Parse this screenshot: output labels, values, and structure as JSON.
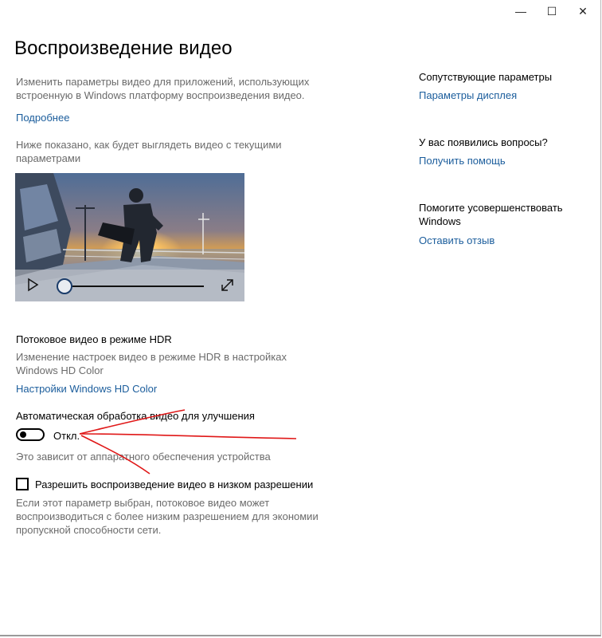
{
  "window": {
    "minimize_glyph": "—",
    "maximize_glyph": "☐",
    "close_glyph": "✕"
  },
  "page": {
    "title": "Воспроизведение видео",
    "intro": "Изменить параметры видео для приложений, использующих встроенную в Windows платформу воспроизведения видео.",
    "learn_more": "Подробнее",
    "preview_caption": "Ниже показано, как будет выглядеть видео с текущими параметрами"
  },
  "video_player": {
    "play_icon": "play-icon",
    "fullscreen_icon": "expand-icon",
    "progress": 0.0
  },
  "hdr": {
    "heading": "Потоковое видео в режиме HDR",
    "description": "Изменение настроек видео в режиме HDR в настройках Windows HD Color",
    "link": "Настройки Windows HD Color"
  },
  "auto_processing": {
    "heading": "Автоматическая обработка видео для улучшения",
    "toggle_state": "Откл.",
    "note": "Это зависит от аппаратного обеспечения устройства"
  },
  "low_res": {
    "checkbox_label": "Разрешить воспроизведение видео в низком разрешении",
    "checked": false,
    "description": "Если этот параметр выбран, потоковое видео может воспроизводиться с более низким разрешением для экономии пропускной способности сети."
  },
  "sidebar": {
    "related_heading": "Сопутствующие параметры",
    "display_link": "Параметры дисплея",
    "questions_heading": "У вас появились вопросы?",
    "help_link": "Получить помощь",
    "improve_heading": "Помогите усовершенствовать Windows",
    "feedback_link": "Оставить отзыв"
  },
  "colors": {
    "link": "#1b5d9c",
    "muted_text": "#6b6b6b",
    "annotation": "#e01818"
  }
}
